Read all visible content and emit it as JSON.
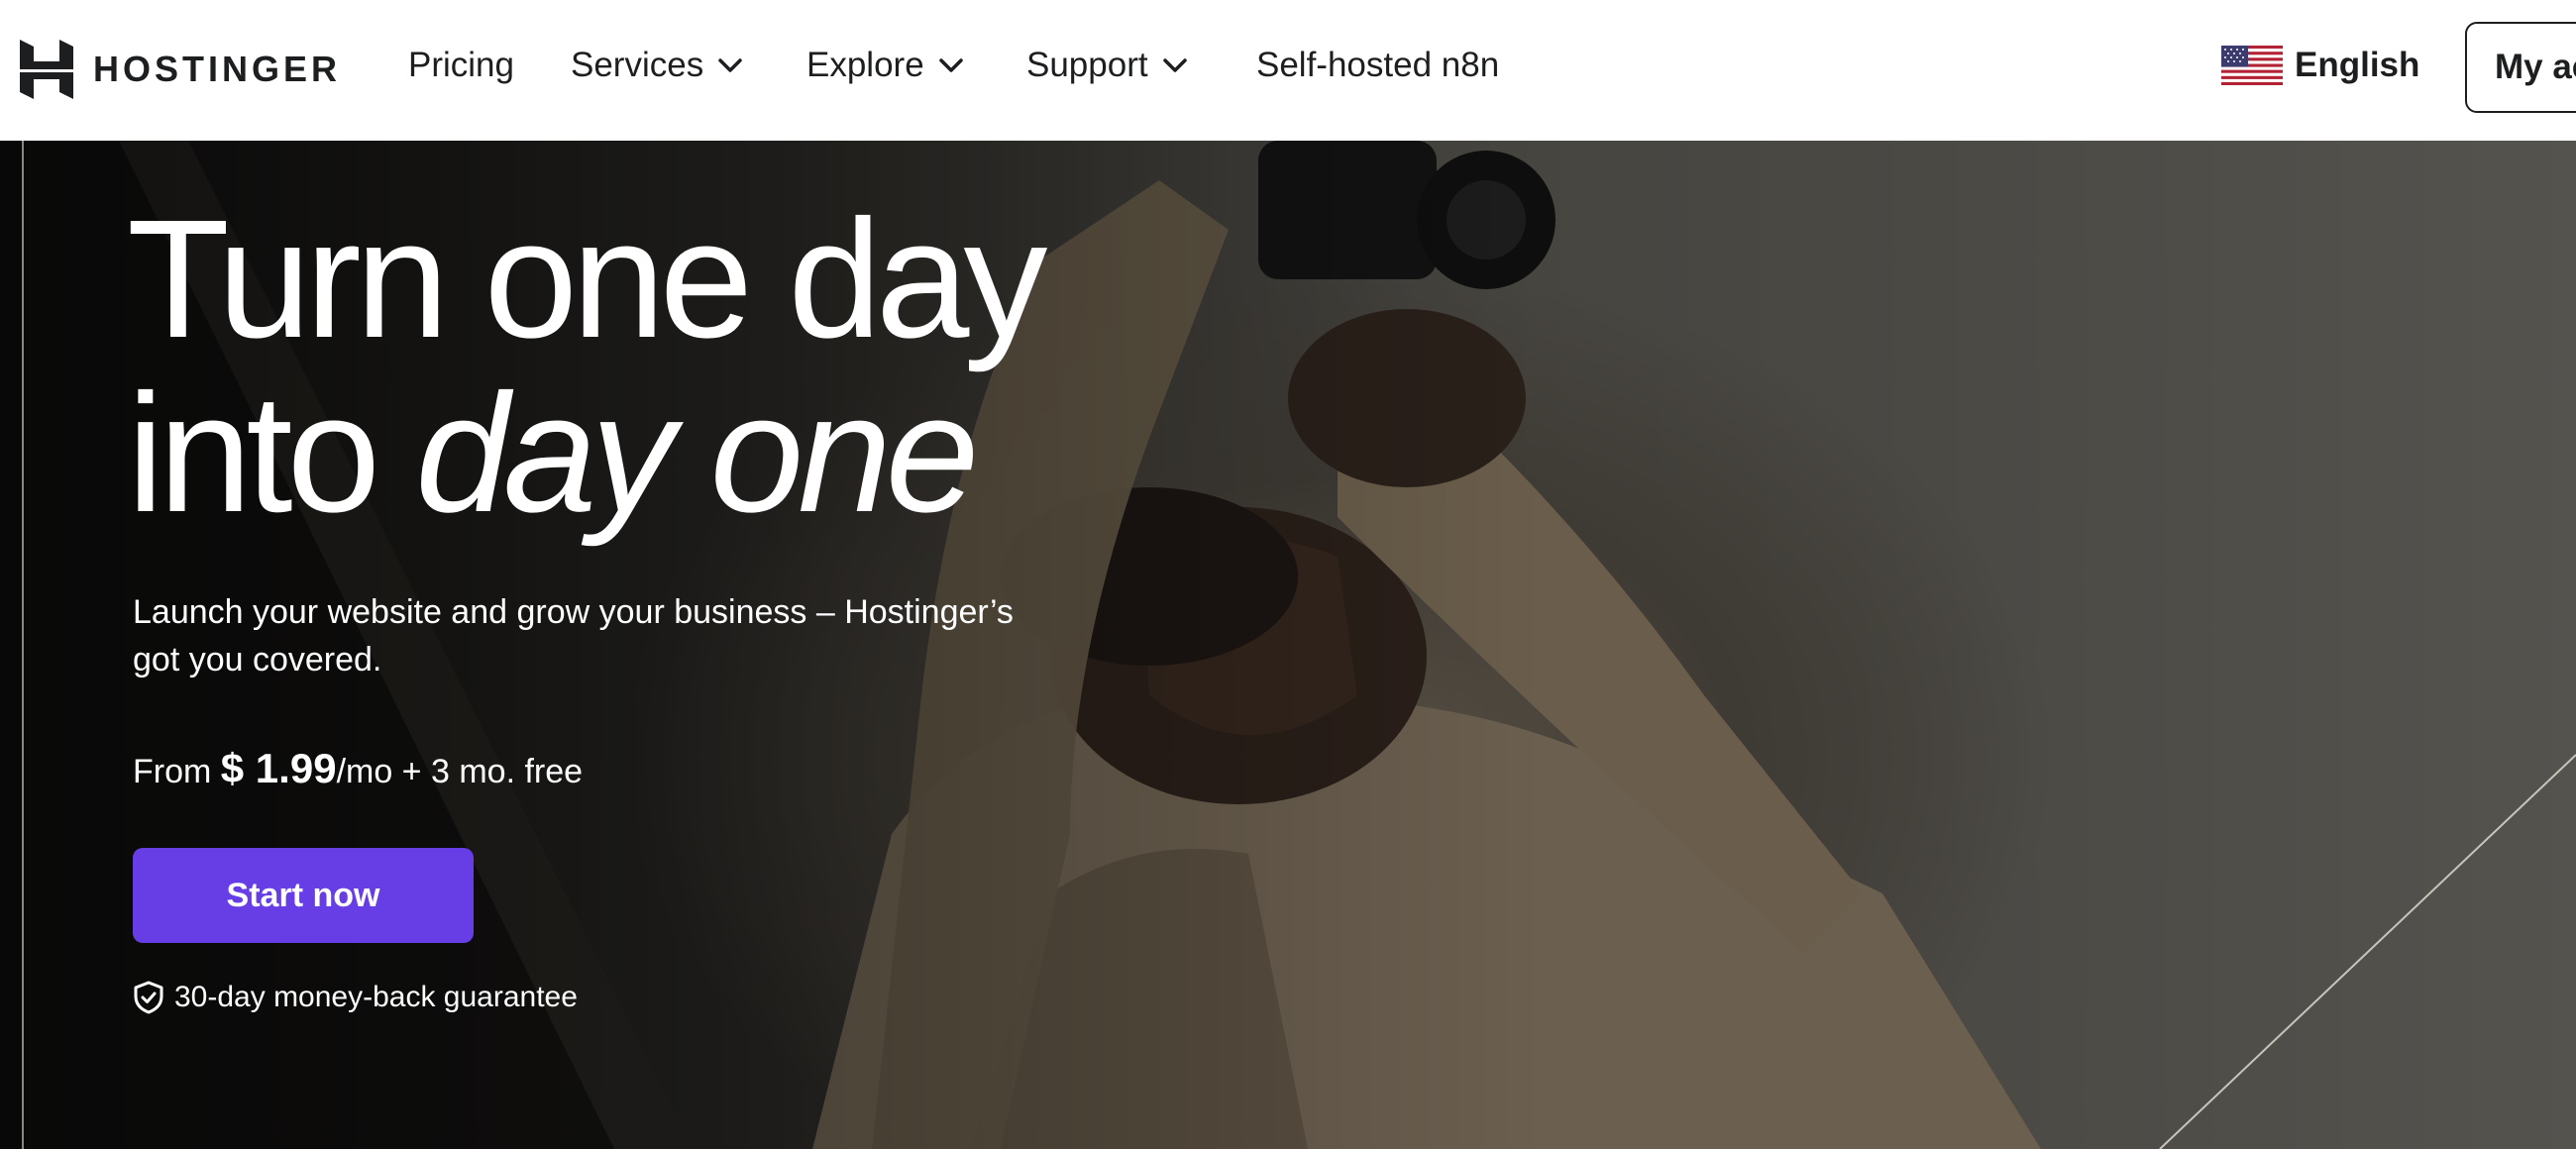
{
  "header": {
    "logo_text": "HOSTINGER",
    "nav": [
      {
        "label": "Pricing",
        "has_dropdown": false
      },
      {
        "label": "Services",
        "has_dropdown": true
      },
      {
        "label": "Explore",
        "has_dropdown": true
      },
      {
        "label": "Support",
        "has_dropdown": true
      },
      {
        "label": "Self-hosted n8n",
        "has_dropdown": false
      }
    ],
    "language": {
      "label": "English",
      "flag_icon": "us-flag-icon"
    },
    "account_button": "My ac"
  },
  "hero": {
    "headline_line1": "Turn one day",
    "headline_line2_plain": "into ",
    "headline_line2_italic": "day one",
    "subtext": "Launch your website and grow your business – Hostinger’s got you covered.",
    "price_prefix": "From ",
    "price_amount": "$ 1.99",
    "price_suffix": "/mo + 3 mo. free",
    "cta_label": "Start now",
    "guarantee_text": "30-day money-back guarantee",
    "guarantee_icon": "shield-check-icon"
  },
  "colors": {
    "brand_purple": "#673de6",
    "header_bg": "#ffffff",
    "text_dark": "#1d1e20"
  }
}
